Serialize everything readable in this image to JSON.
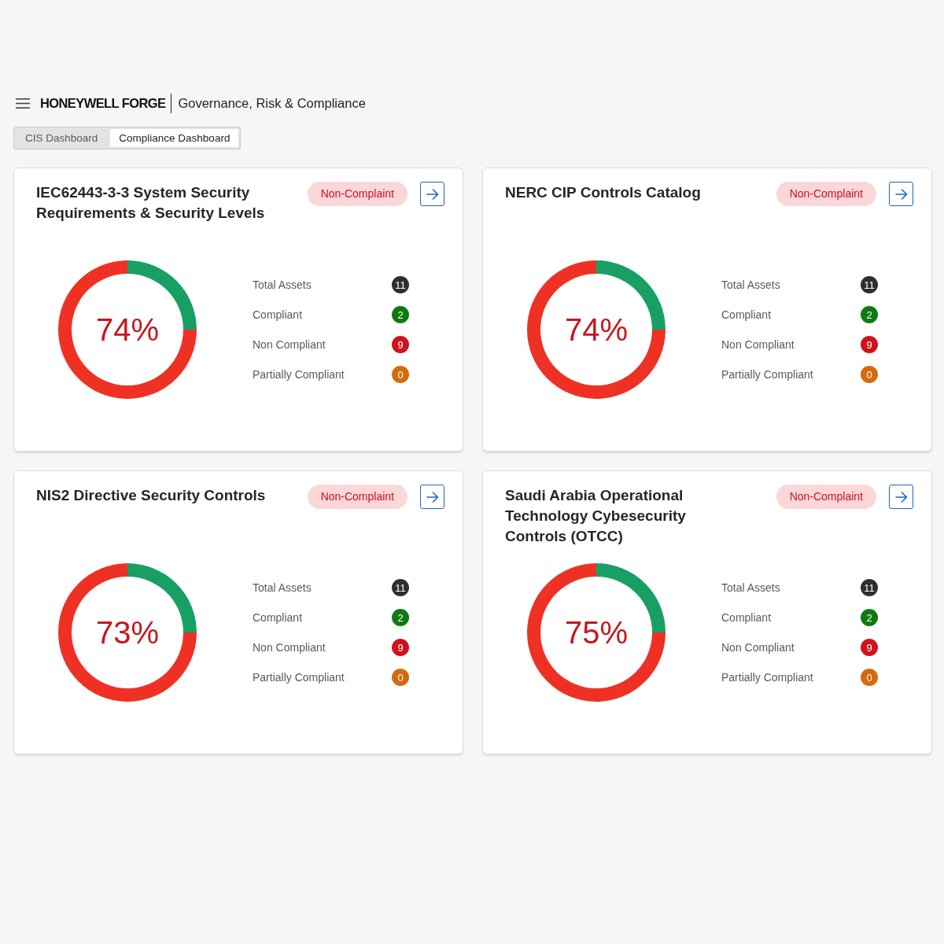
{
  "header": {
    "logo": "HONEYWELL FORGE",
    "app_title": "Governance, Risk & Compliance"
  },
  "tabs": [
    {
      "label": "CIS Dashboard",
      "selected": false
    },
    {
      "label": "Compliance Dashboard",
      "selected": true
    }
  ],
  "cards": [
    {
      "title": "IEC62443-3-3 System Security Requirements & Security Levels",
      "status": "Non-Complaint",
      "score": "74%",
      "stats": [
        {
          "label": "Total Assets",
          "value": "11",
          "color": "#2e2e2e"
        },
        {
          "label": "Compliant",
          "value": "2",
          "color": "#0e7a10"
        },
        {
          "label": "Non Compliant",
          "value": "9",
          "color": "#d0121b"
        },
        {
          "label": "Partially Compliant",
          "value": "0",
          "color": "#d4690e"
        }
      ]
    },
    {
      "title": "NERC CIP Controls Catalog",
      "status": "Non-Complaint",
      "score": "74%",
      "stats": [
        {
          "label": "Total Assets",
          "value": "11",
          "color": "#2e2e2e"
        },
        {
          "label": "Compliant",
          "value": "2",
          "color": "#0e7a10"
        },
        {
          "label": "Non Compliant",
          "value": "9",
          "color": "#d0121b"
        },
        {
          "label": "Partially Compliant",
          "value": "0",
          "color": "#d4690e"
        }
      ]
    },
    {
      "title": "NIS2 Directive Security Controls",
      "status": "Non-Complaint",
      "score": "73%",
      "stats": [
        {
          "label": "Total Assets",
          "value": "11",
          "color": "#2e2e2e"
        },
        {
          "label": "Compliant",
          "value": "2",
          "color": "#0e7a10"
        },
        {
          "label": "Non Compliant",
          "value": "9",
          "color": "#d0121b"
        },
        {
          "label": "Partially Compliant",
          "value": "0",
          "color": "#d4690e"
        }
      ]
    },
    {
      "title": "Saudi Arabia Operational Technology Cybesecurity Controls (OTCC)",
      "status": "Non-Complaint",
      "score": "75%",
      "stats": [
        {
          "label": "Total Assets",
          "value": "11",
          "color": "#2e2e2e"
        },
        {
          "label": "Compliant",
          "value": "2",
          "color": "#0e7a10"
        },
        {
          "label": "Non Compliant",
          "value": "9",
          "color": "#d0121b"
        },
        {
          "label": "Partially Compliant",
          "value": "0",
          "color": "#d4690e"
        }
      ]
    }
  ]
}
